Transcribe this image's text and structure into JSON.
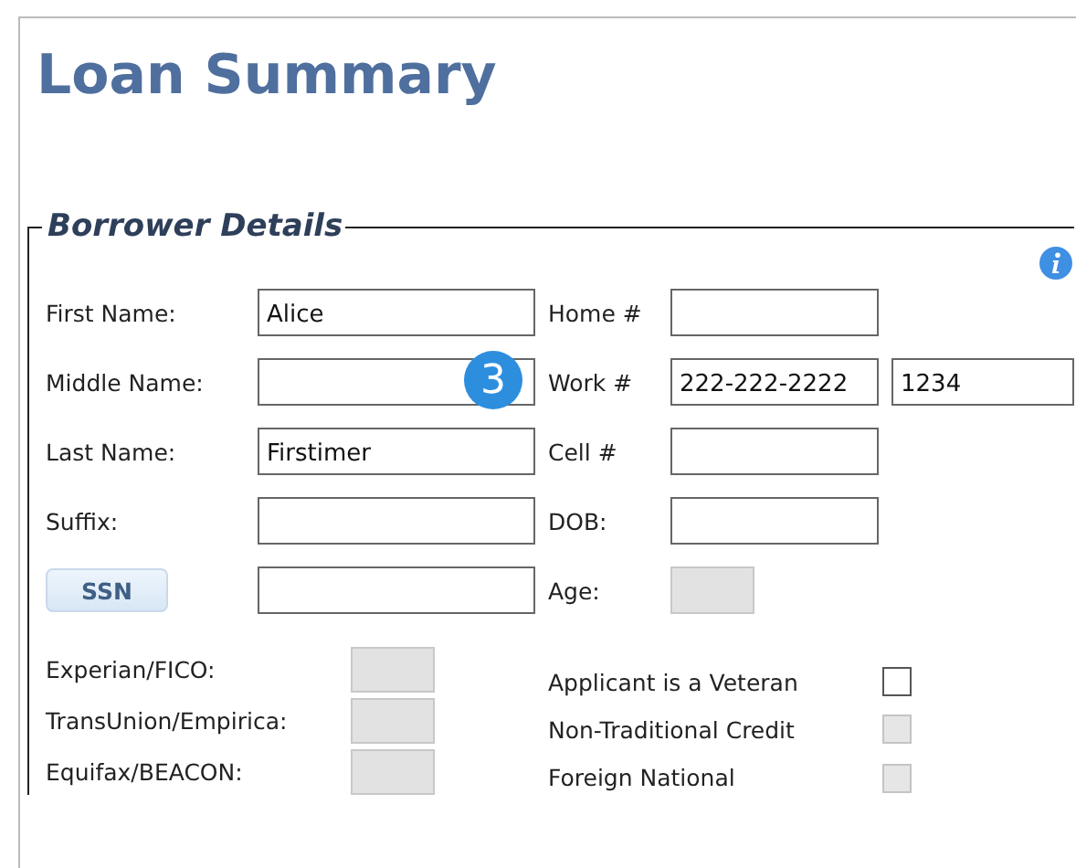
{
  "title": "Loan Summary",
  "section": {
    "legend": "Borrower Details"
  },
  "rows": [
    {
      "left": {
        "kind": "label",
        "label": "First Name:",
        "value": "Alice"
      },
      "right": {
        "label": "Home #",
        "fields": [
          {
            "disabled": false
          }
        ]
      }
    },
    {
      "left": {
        "kind": "label",
        "label": "Middle Name:",
        "badge": "3"
      },
      "right": {
        "label": "Work #",
        "fields": [
          {
            "value": "222-222-2222",
            "disabled": false
          },
          {
            "value": "1234",
            "disabled": false
          }
        ]
      }
    },
    {
      "left": {
        "kind": "label",
        "label": "Last Name:",
        "value": "Firstimer"
      },
      "right": {
        "label": "Cell #",
        "fields": [
          {
            "disabled": false
          }
        ]
      }
    },
    {
      "left": {
        "kind": "label",
        "label": "Suffix:"
      },
      "right": {
        "label": "DOB:",
        "fields": [
          {
            "disabled": false
          }
        ]
      }
    },
    {
      "left": {
        "kind": "button",
        "label": "SSN"
      },
      "right": {
        "label": "Age:",
        "fields": [
          {
            "disabled": true
          }
        ]
      }
    }
  ],
  "scores": [
    {
      "label": "Experian/FICO:",
      "disabled": true
    },
    {
      "label": "TransUnion/Empirica:",
      "disabled": true
    },
    {
      "label": "Equifax/BEACON:",
      "disabled": true
    }
  ],
  "flags": [
    {
      "label": "Applicant is a Veteran",
      "checked": false,
      "disabled": false
    },
    {
      "label": "Non-Traditional Credit",
      "checked": false,
      "disabled": true
    },
    {
      "label": "Foreign National",
      "checked": false,
      "disabled": true
    }
  ]
}
